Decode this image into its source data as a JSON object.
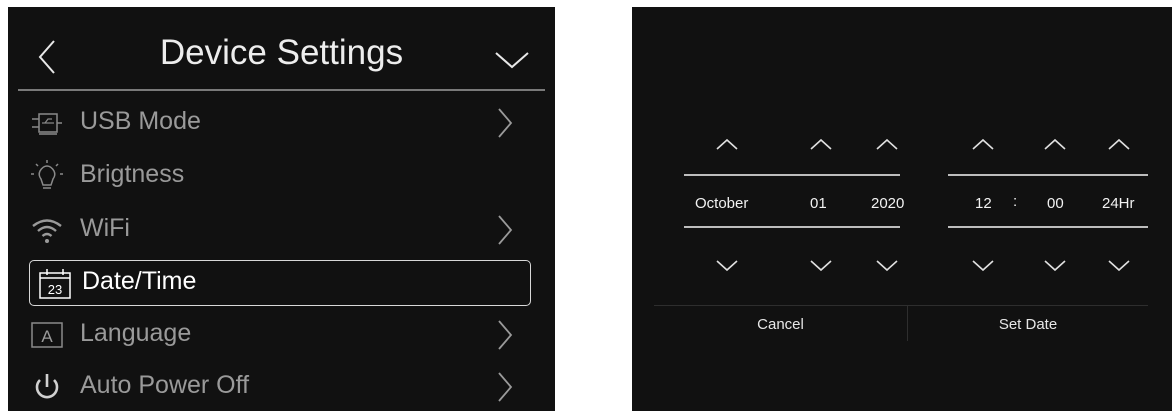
{
  "settings": {
    "title": "Device Settings",
    "back_icon": "back-arrow-icon",
    "collapse_icon": "chevron-down-icon",
    "items": [
      {
        "label": "USB Mode",
        "icon": "usb-icon",
        "arrow": true
      },
      {
        "label": "Brigtness",
        "icon": "lightbulb-icon",
        "arrow": false
      },
      {
        "label": "WiFi",
        "icon": "wifi-icon",
        "arrow": true
      },
      {
        "label": "Date/Time",
        "icon": "calendar-icon",
        "arrow": false,
        "selected": true,
        "icon_text": "23"
      },
      {
        "label": "Language",
        "icon": "language-icon",
        "arrow": true,
        "icon_text": "A"
      },
      {
        "label": "Auto Power Off",
        "icon": "power-icon",
        "arrow": true
      }
    ]
  },
  "date_picker": {
    "month": "October",
    "day": "01",
    "year": "2020",
    "hour": "12",
    "separator": ":",
    "minute": "00",
    "format": "24Hr",
    "cancel_label": "Cancel",
    "set_label": "Set Date"
  },
  "colors": {
    "panel_bg": "#111111",
    "text_primary": "#ffffff",
    "text_dim": "#9a9a9a"
  }
}
